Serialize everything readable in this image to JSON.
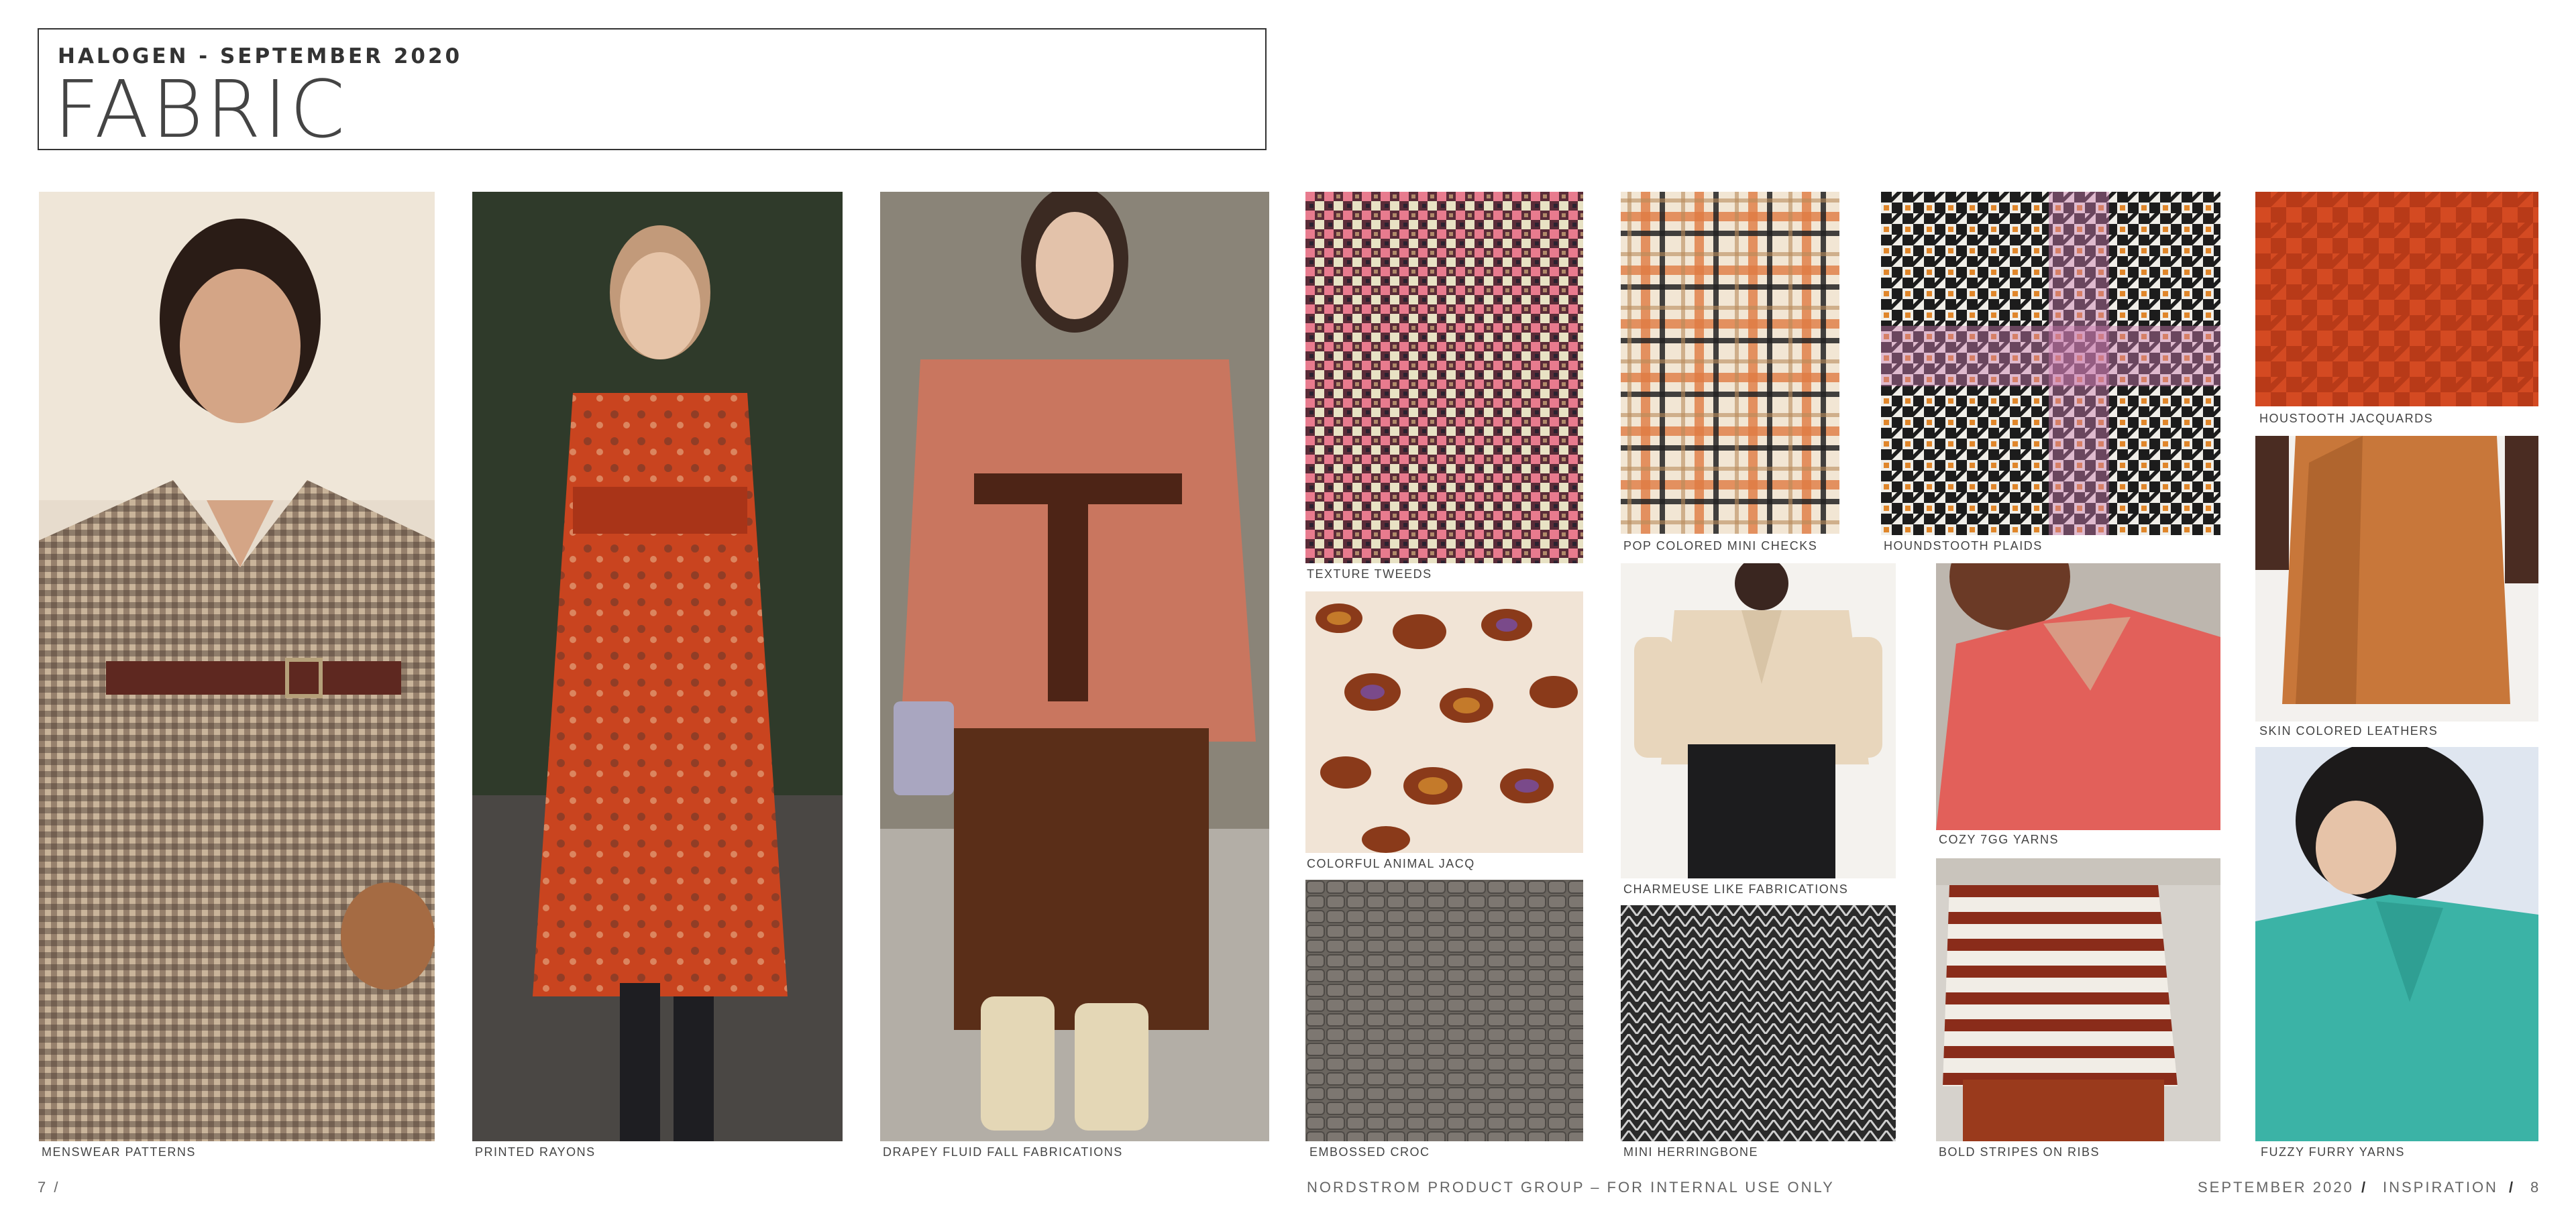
{
  "header": {
    "supertitle": "HALOGEN - SEPTEMBER 2020",
    "title": "FABRIC"
  },
  "captions": {
    "menswear": "MENSWEAR PATTERNS",
    "rayons": "PRINTED RAYONS",
    "drapey": "DRAPEY FLUID FALL FABRICATIONS",
    "tweeds": "TEXTURE TWEEDS",
    "checks": "POP COLORED MINI CHECKS",
    "plaids": "HOUNDSTOOTH PLAIDS",
    "jacquards": "HOUSTOOTH JACQUARDS",
    "animal": "COLORFUL ANIMAL JACQ",
    "charmeuse": "CHARMEUSE LIKE FABRICATIONS",
    "cozy": "COZY 7GG YARNS",
    "leathers": "SKIN COLORED LEATHERS",
    "croc": "EMBOSSED CROC",
    "herringbone": "MINI HERRINGBONE",
    "stripes": "BOLD STRIPES ON RIBS",
    "fuzzy": "FUZZY  FURRY YARNS"
  },
  "footer": {
    "page_left": "7  /",
    "center": "NORDSTROM PRODUCT GROUP  –  FOR INTERNAL USE ONLY",
    "right_date": "SEPTEMBER 2020",
    "sep1": "/",
    "right_section": "INSPIRATION",
    "sep2": "/",
    "page_right": "8"
  }
}
